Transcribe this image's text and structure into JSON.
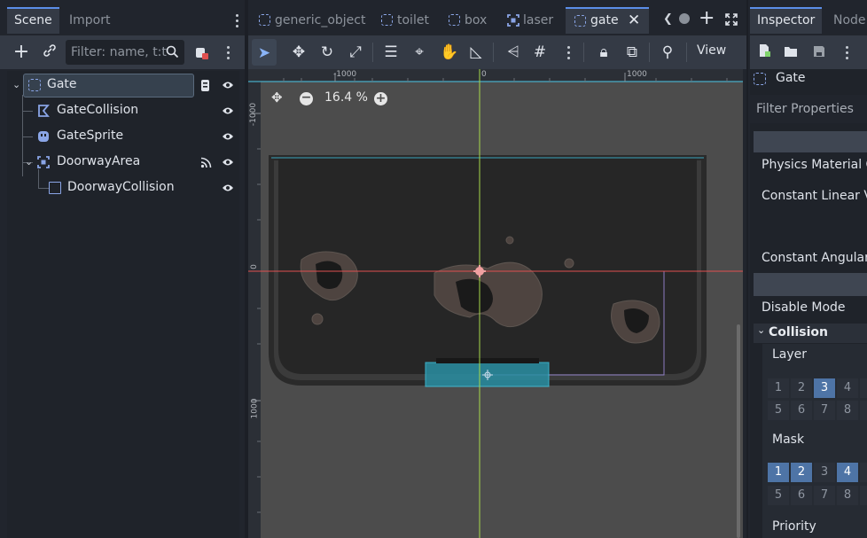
{
  "scene_dock": {
    "tabs": [
      "Scene",
      "Import"
    ],
    "filter_placeholder": "Filter: name, t:t",
    "nodes": [
      {
        "label": "Gate",
        "icon": "node2d-icon"
      },
      {
        "label": "GateCollision",
        "icon": "collision-polygon-icon"
      },
      {
        "label": "GateSprite",
        "icon": "sprite-icon"
      },
      {
        "label": "DoorwayArea",
        "icon": "area2d-icon"
      },
      {
        "label": "DoorwayCollision",
        "icon": "collision-shape-icon"
      }
    ]
  },
  "editor": {
    "tabs": [
      "generic_object",
      "toilet",
      "box",
      "laser",
      "gate"
    ],
    "active_tab": "gate",
    "view_menu": "View",
    "zoom": "16.4 %",
    "ruler": {
      "top_ticks": [
        "-1000",
        "0",
        "1000"
      ],
      "left_ticks": [
        "-1000",
        "0",
        "1000"
      ]
    }
  },
  "inspector": {
    "tabs": [
      "Inspector",
      "Node"
    ],
    "object_name": "Gate",
    "filter_placeholder": "Filter Properties",
    "properties": {
      "physics_material": "Physics Material O",
      "constant_linear": "Constant Linear Ve",
      "constant_angular": "Constant Angular",
      "disable_mode": "Disable Mode"
    },
    "section": "Collision",
    "layer_label": "Layer",
    "mask_label": "Mask",
    "priority_label": "Priority",
    "layer_bits": {
      "row1": [
        "1",
        "2",
        "3",
        "4"
      ],
      "row2": [
        "5",
        "6",
        "7",
        "8"
      ],
      "on": [
        3
      ]
    },
    "mask_bits": {
      "row1": [
        "1",
        "2",
        "3",
        "4"
      ],
      "row2": [
        "5",
        "6",
        "7",
        "8"
      ],
      "on": [
        1,
        2,
        4
      ]
    }
  },
  "colors": {
    "accent": "#5b8ee8",
    "x_axis": "#e05050",
    "y_axis": "#a6d84a",
    "selection": "#3aa4bc"
  }
}
